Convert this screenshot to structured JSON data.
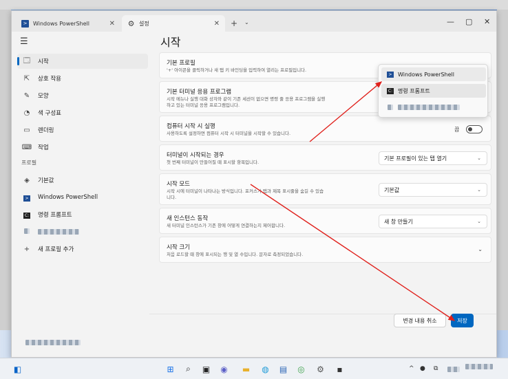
{
  "window": {
    "tabs": [
      {
        "label": "Windows PowerShell",
        "close": "✕"
      },
      {
        "label": "설정",
        "close": "✕"
      }
    ],
    "new_tab": "+",
    "tab_dropdown": "⌄",
    "controls": {
      "minimize": "—",
      "maximize": "▢",
      "close": "✕"
    }
  },
  "sidebar": {
    "menu": "☰",
    "items": [
      {
        "label": "시작",
        "icon": "🗔"
      },
      {
        "label": "상호 작용",
        "icon": "⇱"
      },
      {
        "label": "모양",
        "icon": "✎"
      },
      {
        "label": "색 구성표",
        "icon": "◔"
      },
      {
        "label": "렌더링",
        "icon": "▭"
      },
      {
        "label": "작업",
        "icon": "⌨"
      }
    ],
    "profiles_header": "프로필",
    "profiles": [
      {
        "label": "기본값",
        "icon": "◈"
      },
      {
        "label": "Windows PowerShell",
        "icon": "PS"
      },
      {
        "label": "명령 프롬프트",
        "icon": "C:"
      }
    ],
    "add_profile": "새 프로필 추가",
    "add_icon": "+"
  },
  "page": {
    "title": "시작",
    "settings": [
      {
        "title": "기본 프로필",
        "desc": "'+' 아이콘을 클릭하거나 새 탭 키 바인딩을 입력하여 열리는 프로필입니다."
      },
      {
        "title": "기본 터미널 응용 프로그램",
        "desc": "시작 메뉴나 실행 대화 상자와 같이 기존 세션이 없으면 명령 줄 응용 프로그램을 실행",
        "desc2": "하고 있는 터미널 응용 프로그램입니다."
      },
      {
        "title": "컴퓨터 시작 시 실행",
        "desc": "사용하도록 설정하면 컴퓨터 시작 시 터미널을 시작할 수 있습니다.",
        "toggle_label": "끔"
      },
      {
        "title": "터미널이 시작되는 경우",
        "desc": "첫 번째 터미널이 만들어질 때 표시할 항목입니다.",
        "value": "기본 프로필이 있는 탭 열기"
      },
      {
        "title": "시작 모드",
        "desc": "시작 시에 터미널이 나타나는 방식입니다. 포커스가 탭과 제목 표시줄을 숨길 수 있습",
        "desc2": "니다.",
        "value": "기본값"
      },
      {
        "title": "새 인스턴스 동작",
        "desc": "새 터미널 인스턴스가 기존 창에 어떻게 연결하는지 제어합니다.",
        "value": "새 창 만들기"
      },
      {
        "title": "시작 크기",
        "desc": "처음 로드할 때 창에 표시되는 행 및 열 수입니다. 문자로 측정되었습니다."
      }
    ],
    "chevron": "⌄",
    "expand_chevron": "⌄"
  },
  "popup": {
    "items": [
      {
        "label": "Windows PowerShell",
        "icon": "PS"
      },
      {
        "label": "명령 프롬프트",
        "icon": "C:"
      }
    ]
  },
  "footer": {
    "discard": "변경 내용 취소",
    "save": "저장"
  },
  "taskbar": {
    "tray_chevron": "^"
  },
  "colors": {
    "accent": "#0067c0",
    "arrow": "#e0211c"
  }
}
